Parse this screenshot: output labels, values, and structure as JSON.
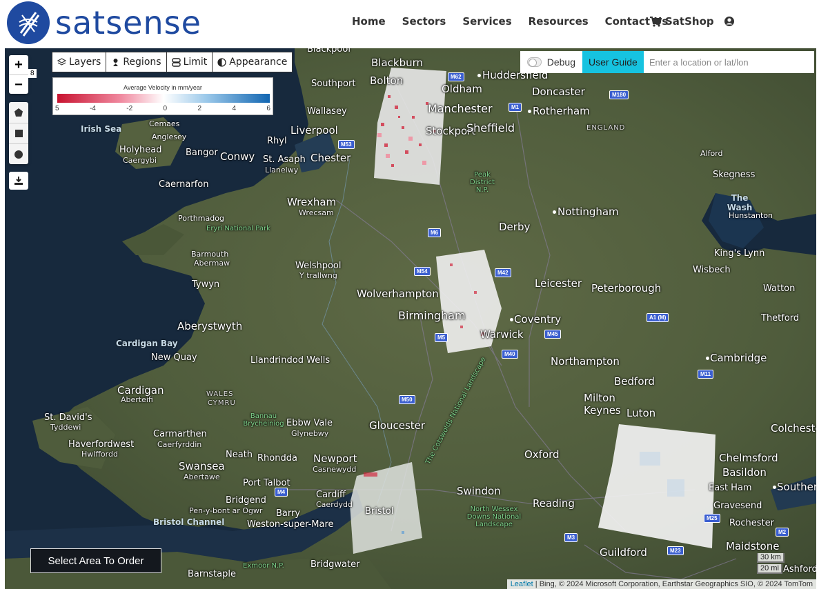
{
  "brand": {
    "name": "satsense"
  },
  "nav": {
    "items": [
      "Home",
      "Sectors",
      "Services",
      "Resources",
      "Contact Us"
    ],
    "shop": "SatShop"
  },
  "map_controls": {
    "zoom_in": "+",
    "zoom_out": "−",
    "zoom_level": "8",
    "tabs": [
      "Layers",
      "Regions",
      "Limit",
      "Appearance"
    ],
    "debug_label": "Debug",
    "user_guide": "User Guide",
    "search_placeholder": "Enter a location or lat/lon",
    "order_button": "Select Area To Order",
    "scale_km": "30 km",
    "scale_mi": "20 mi",
    "attribution_leaflet": "Leaflet",
    "attribution_rest": "| Bing, © 2024 Microsoft Corporation, Earthstar Geographics SIO, © 2024 TomTom"
  },
  "legend": {
    "title": "Average Velocity in mm/year",
    "ticks": [
      "5",
      "-4",
      "-2",
      "0",
      "2",
      "4",
      "6"
    ]
  },
  "map_labels": {
    "blackpool": "Blackpool",
    "blackburn": "Blackburn",
    "bolton": "Bolton",
    "oldham": "Oldham",
    "huddersfield": "Huddersfield",
    "doncaster": "Doncaster",
    "southport": "Southport",
    "manchester": "Manchester",
    "stockport": "Stockport",
    "rotherham": "Rotherham",
    "sheffield": "Sheffield",
    "wallasey": "Wallasey",
    "liverpool": "Liverpool",
    "england": "ENGLAND",
    "irish_sea": "Irish Sea",
    "cemaes": "Cemaes",
    "anglesey": "Anglesey",
    "holyhead": "Holyhead",
    "caergybi": "Caergybi",
    "bangor": "Bangor",
    "conwy": "Conwy",
    "rhyl": "Rhyl",
    "st_asaph": "St. Asaph",
    "llanelwy": "Llanelwy",
    "chester": "Chester",
    "alford": "Alford",
    "skegness": "Skegness",
    "caernarfon": "Caernarfon",
    "peak_district": "Peak District N.P.",
    "the_wash": "The Wash",
    "hunstanton": "Hunstanton",
    "wrexham": "Wrexham",
    "wrecsam": "Wrecsam",
    "nottingham": "Nottingham",
    "porthmadog": "Porthmadog",
    "eryri": "Eryri National Park",
    "derby": "Derby",
    "kings_lynn": "King's Lynn",
    "barmouth": "Barmouth",
    "abermaw": "Abermaw",
    "welshpool": "Welshpool",
    "trallwng": "Y trallwng",
    "wisbech": "Wisbech",
    "leicester": "Leicester",
    "peterborough": "Peterborough",
    "tywyn": "Tywyn",
    "wolverhampton": "Wolverhampton",
    "watton": "Watton",
    "birmingham": "Birmingham",
    "coventry": "Coventry",
    "thetford": "Thetford",
    "aberystwyth": "Aberystwyth",
    "warwick": "Warwick",
    "cardigan_bay": "Cardigan Bay",
    "new_quay": "New Quay",
    "llandrindod": "Llandrindod Wells",
    "northampton": "Northampton",
    "cambridge": "Cambridge",
    "bedford": "Bedford",
    "cardigan": "Cardigan",
    "aberteifi": "Aberteifi",
    "wales": "WALES",
    "cymru": "CYMRU",
    "milton_keynes": "Milton Keynes",
    "st_davids": "St. David's",
    "tyddewi": "Tyddewi",
    "bannau": "Bannau Brycheiniog",
    "ebbw_vale": "Ebbw Vale",
    "glynebwy": "Glynebwy",
    "gloucester": "Gloucester",
    "luton": "Luton",
    "colchester": "Colchester",
    "haverfordwest": "Haverfordwest",
    "hwlffordd": "Hwlffordd",
    "carmarthen": "Carmarthen",
    "caerfyrddin": "Caerfyrddin",
    "cotswolds": "The Cotswolds National Landscape",
    "neath": "Neath",
    "rhondda": "Rhondda",
    "newport": "Newport",
    "casnewydd": "Casnewydd",
    "oxford": "Oxford",
    "chelmsford": "Chelmsford",
    "swansea": "Swansea",
    "abertawe": "Abertawe",
    "basildon": "Basildon",
    "port_talbot": "Port Talbot",
    "swindon": "Swindon",
    "cardiff": "Cardiff",
    "caerdydd": "Caerdydd",
    "east_ham": "East Ham",
    "southend": "Southend",
    "bridgend": "Bridgend",
    "penybont": "Pen-y-bont ar Ogwr",
    "bristol": "Bristol",
    "reading": "Reading",
    "north_wessex": "North Wessex Downs National Landscape",
    "gravesend": "Gravesend",
    "barry": "Barry",
    "bristol_channel": "Bristol Channel",
    "weston": "Weston-super-Mare",
    "rochester": "Rochester",
    "maidstone": "Maidstone",
    "guildford": "Guildford",
    "exmoor": "Exmoor N.P.",
    "bridgwater": "Bridgwater",
    "barnstaple": "Barnstaple",
    "ashford": "Ashford"
  },
  "motorways": [
    "M62",
    "M1",
    "M180",
    "M53",
    "M6",
    "M54",
    "M42",
    "M5",
    "M45",
    "M40",
    "A1 (M)",
    "M11",
    "M50",
    "M4",
    "M25",
    "M3",
    "M2",
    "M23"
  ]
}
